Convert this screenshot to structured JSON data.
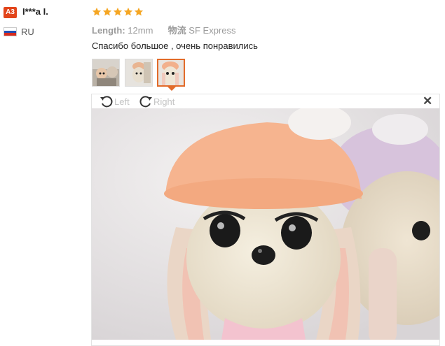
{
  "reviewer": {
    "badge": "A3",
    "name": "I***a I.",
    "country": "RU",
    "flag_colors": [
      "#ffffff",
      "#1f4fb5",
      "#d52b1e"
    ]
  },
  "review": {
    "rating": 5,
    "rating_max": 5,
    "star_color": "#f5a623",
    "length_label": "Length:",
    "length_value": "12mm",
    "shipping_label": "物流",
    "shipping_value": "SF Express",
    "text": "Спасибо большое , очень понравились"
  },
  "thumbnails": {
    "count": 3,
    "active_index": 3,
    "active_border_color": "#e26b2a"
  },
  "viewer": {
    "rotate_left_label": "Left",
    "rotate_right_label": "Right",
    "close_symbol": "✕"
  }
}
